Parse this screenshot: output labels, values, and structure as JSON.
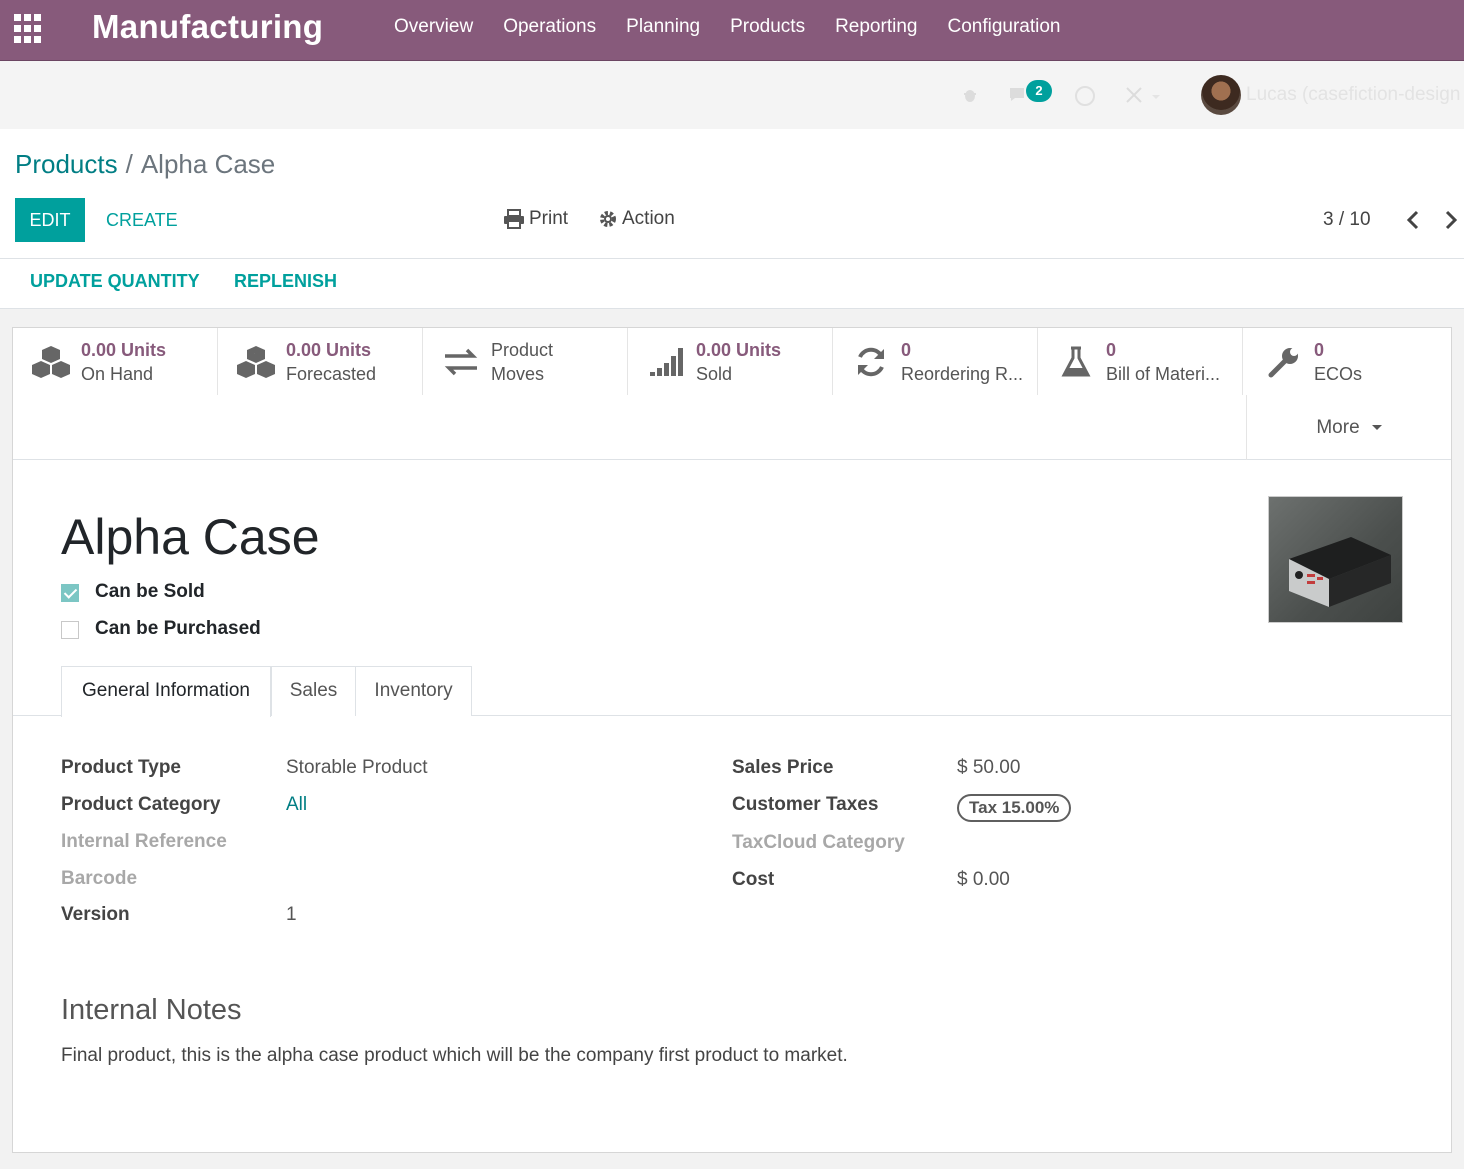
{
  "app": {
    "title": "Manufacturing"
  },
  "menu": [
    "Overview",
    "Operations",
    "Planning",
    "Products",
    "Reporting",
    "Configuration"
  ],
  "systray": {
    "messages_count": "2",
    "user_name": "Lucas (casefiction-design"
  },
  "breadcrumb": {
    "parent": "Products",
    "current": "Alpha Case"
  },
  "toolbar": {
    "edit": "EDIT",
    "create": "CREATE",
    "print": "Print",
    "action": "Action"
  },
  "pager": {
    "value": "3 / 10"
  },
  "statusbar": {
    "update_qty": "UPDATE QUANTITY",
    "replenish": "REPLENISH"
  },
  "smart_buttons": [
    {
      "value": "0.00 Units",
      "label": "On Hand",
      "icon": "cubes-icon"
    },
    {
      "value": "0.00 Units",
      "label": "Forecasted",
      "icon": "cubes-icon"
    },
    {
      "value": "Product",
      "label": "Moves",
      "icon": "exchange-icon"
    },
    {
      "value": "0.00 Units",
      "label": "Sold",
      "icon": "signal-icon"
    },
    {
      "value": "0",
      "label": "Reordering R...",
      "icon": "refresh-icon"
    },
    {
      "value": "0",
      "label": "Bill of Materi...",
      "icon": "flask-icon"
    },
    {
      "value": "0",
      "label": "ECOs",
      "icon": "wrench-icon"
    }
  ],
  "more": "More",
  "product": {
    "name": "Alpha Case",
    "can_be_sold": {
      "label": "Can be Sold",
      "checked": true
    },
    "can_be_purchased": {
      "label": "Can be Purchased",
      "checked": false
    }
  },
  "tabs": [
    "General Information",
    "Sales",
    "Inventory"
  ],
  "fields_left": [
    {
      "label": "Product Type",
      "value": "Storable Product"
    },
    {
      "label": "Product Category",
      "value": "All"
    },
    {
      "label": "Internal Reference",
      "value": ""
    },
    {
      "label": "Barcode",
      "value": ""
    },
    {
      "label": "Version",
      "value": "1"
    }
  ],
  "fields_right": [
    {
      "label": "Sales Price",
      "value": "$ 50.00"
    },
    {
      "label": "Customer Taxes",
      "value": "Tax 15.00%"
    },
    {
      "label": "TaxCloud Category",
      "value": ""
    },
    {
      "label": "Cost",
      "value": "$ 0.00"
    }
  ],
  "notes": {
    "title": "Internal Notes",
    "body": "Final product, this is the alpha case product which will be the company first product to market."
  },
  "colors": {
    "brand": "#875a7b",
    "primary": "#00a09d",
    "link": "#017e84"
  }
}
